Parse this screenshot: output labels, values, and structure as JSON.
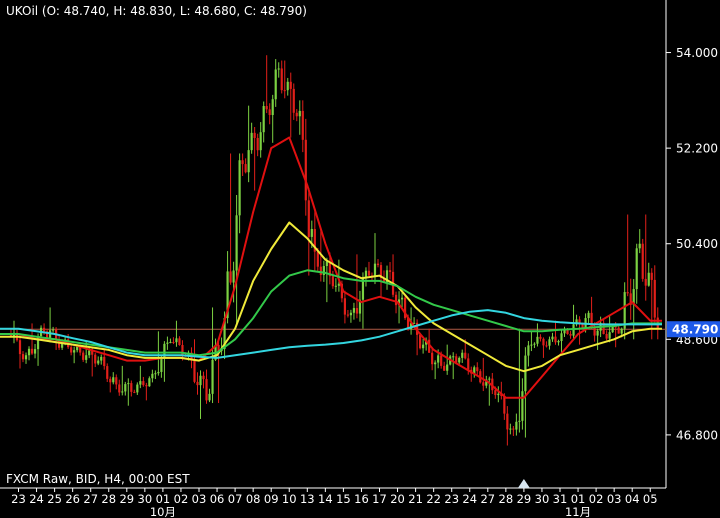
{
  "header": {
    "title": "UKOil (O: 48.740, H: 48.830, L: 48.680, C: 48.790)"
  },
  "footer": {
    "info": "FXCM Raw, BID, H4, 00:00 EST"
  },
  "colors": {
    "background": "#000000",
    "bull": "#7cd142",
    "bear": "#e2201a",
    "ma_red": "#e01010",
    "ma_yellow": "#f0ea3a",
    "ma_green": "#33c94a",
    "ma_cyan": "#33d6e0",
    "price_line": "#b05a45",
    "price_label_bg": "#1e5ae8",
    "axis": "#ffffff"
  },
  "chart_data": {
    "type": "candlestick",
    "symbol": "UKOil",
    "timeframe": "H4",
    "last_price": 48.79,
    "last_price_label": "48.790",
    "ylim": [
      45.8,
      54.5
    ],
    "yticks": [
      {
        "value": 54.0,
        "label": "54.000"
      },
      {
        "value": 52.2,
        "label": "52.200"
      },
      {
        "value": 50.4,
        "label": "50.400"
      },
      {
        "value": 48.6,
        "label": "48.600"
      },
      {
        "value": 46.8,
        "label": "46.800"
      }
    ],
    "xticks": [
      "23",
      "24",
      "25",
      "26",
      "27",
      "28",
      "29",
      "30",
      "01",
      "02",
      "03",
      "06",
      "07",
      "08",
      "09",
      "10",
      "13",
      "14",
      "15",
      "16",
      "17",
      "20",
      "21",
      "22",
      "23",
      "24",
      "27",
      "28",
      "29",
      "30",
      "31",
      "01",
      "02",
      "03",
      "04",
      "05"
    ],
    "month_labels": [
      {
        "text": "10月",
        "tick_index": 8
      },
      {
        "text": "11月",
        "tick_index": 31
      }
    ],
    "marker_tick_index": 28,
    "days": [
      {
        "o": 48.7,
        "h": 48.95,
        "l": 48.05,
        "c": 48.3
      },
      {
        "o": 48.3,
        "h": 48.9,
        "l": 48.1,
        "c": 48.75
      },
      {
        "o": 48.75,
        "h": 49.2,
        "l": 48.4,
        "c": 48.55
      },
      {
        "o": 48.55,
        "h": 48.7,
        "l": 48.15,
        "c": 48.35
      },
      {
        "o": 48.35,
        "h": 48.55,
        "l": 47.9,
        "c": 48.2
      },
      {
        "o": 48.2,
        "h": 48.4,
        "l": 47.6,
        "c": 47.75
      },
      {
        "o": 47.75,
        "h": 48.1,
        "l": 47.35,
        "c": 47.6
      },
      {
        "o": 47.6,
        "h": 48.1,
        "l": 47.45,
        "c": 47.95
      },
      {
        "o": 47.95,
        "h": 48.75,
        "l": 47.8,
        "c": 48.55
      },
      {
        "o": 48.55,
        "h": 48.95,
        "l": 48.2,
        "c": 48.35
      },
      {
        "o": 48.35,
        "h": 48.6,
        "l": 47.1,
        "c": 47.45
      },
      {
        "o": 47.45,
        "h": 49.2,
        "l": 47.4,
        "c": 49.0
      },
      {
        "o": 49.0,
        "h": 52.1,
        "l": 48.9,
        "c": 51.9
      },
      {
        "o": 51.9,
        "h": 53.0,
        "l": 51.4,
        "c": 52.5
      },
      {
        "o": 52.5,
        "h": 53.95,
        "l": 52.3,
        "c": 53.7
      },
      {
        "o": 53.7,
        "h": 53.85,
        "l": 52.4,
        "c": 52.8
      },
      {
        "o": 52.8,
        "h": 53.1,
        "l": 49.8,
        "c": 50.25
      },
      {
        "o": 50.25,
        "h": 50.7,
        "l": 49.3,
        "c": 49.6
      },
      {
        "o": 49.6,
        "h": 50.1,
        "l": 48.9,
        "c": 49.1
      },
      {
        "o": 49.1,
        "h": 50.2,
        "l": 48.8,
        "c": 49.8
      },
      {
        "o": 49.8,
        "h": 50.6,
        "l": 49.4,
        "c": 49.9
      },
      {
        "o": 49.9,
        "h": 50.2,
        "l": 48.9,
        "c": 49.0
      },
      {
        "o": 49.0,
        "h": 49.2,
        "l": 48.3,
        "c": 48.5
      },
      {
        "o": 48.5,
        "h": 48.8,
        "l": 47.85,
        "c": 48.1
      },
      {
        "o": 48.1,
        "h": 48.5,
        "l": 47.85,
        "c": 48.25
      },
      {
        "o": 48.25,
        "h": 48.6,
        "l": 47.8,
        "c": 48.0
      },
      {
        "o": 48.0,
        "h": 48.25,
        "l": 47.35,
        "c": 47.55
      },
      {
        "o": 47.55,
        "h": 47.8,
        "l": 46.6,
        "c": 46.9
      },
      {
        "o": 46.9,
        "h": 48.8,
        "l": 46.75,
        "c": 48.5
      },
      {
        "o": 48.5,
        "h": 48.9,
        "l": 48.25,
        "c": 48.6
      },
      {
        "o": 48.6,
        "h": 48.95,
        "l": 48.35,
        "c": 48.7
      },
      {
        "o": 48.7,
        "h": 49.25,
        "l": 48.5,
        "c": 49.0
      },
      {
        "o": 49.0,
        "h": 49.4,
        "l": 48.4,
        "c": 48.7
      },
      {
        "o": 48.7,
        "h": 49.05,
        "l": 48.45,
        "c": 48.8
      },
      {
        "o": 48.8,
        "h": 50.95,
        "l": 48.6,
        "c": 50.4
      },
      {
        "o": 50.4,
        "h": 50.95,
        "l": 48.6,
        "c": 48.79
      }
    ],
    "series": [
      {
        "color": "#e01010",
        "values": [
          48.7,
          48.6,
          48.6,
          48.5,
          48.4,
          48.3,
          48.2,
          48.2,
          48.25,
          48.25,
          48.2,
          48.5,
          49.6,
          51.0,
          52.2,
          52.4,
          51.5,
          50.4,
          49.5,
          49.3,
          49.4,
          49.3,
          48.8,
          48.4,
          48.2,
          48.0,
          47.8,
          47.5,
          47.5,
          47.9,
          48.3,
          48.7,
          48.9,
          49.1,
          49.3,
          48.95
        ]
      },
      {
        "color": "#f0ea3a",
        "values": [
          48.65,
          48.6,
          48.55,
          48.5,
          48.45,
          48.4,
          48.3,
          48.25,
          48.25,
          48.25,
          48.2,
          48.3,
          48.8,
          49.7,
          50.3,
          50.8,
          50.5,
          50.1,
          49.9,
          49.75,
          49.8,
          49.6,
          49.2,
          48.9,
          48.7,
          48.5,
          48.3,
          48.1,
          48.0,
          48.1,
          48.3,
          48.4,
          48.5,
          48.6,
          48.75,
          48.8
        ]
      },
      {
        "color": "#33c94a",
        "values": [
          48.7,
          48.65,
          48.6,
          48.55,
          48.5,
          48.45,
          48.4,
          48.35,
          48.35,
          48.35,
          48.3,
          48.35,
          48.6,
          49.0,
          49.5,
          49.8,
          49.9,
          49.85,
          49.75,
          49.7,
          49.7,
          49.6,
          49.4,
          49.25,
          49.15,
          49.05,
          48.95,
          48.85,
          48.75,
          48.75,
          48.78,
          48.8,
          48.83,
          48.85,
          48.9,
          48.9
        ]
      },
      {
        "color": "#33d6e0",
        "values": [
          48.8,
          48.75,
          48.7,
          48.62,
          48.55,
          48.45,
          48.35,
          48.3,
          48.3,
          48.3,
          48.27,
          48.25,
          48.3,
          48.35,
          48.4,
          48.45,
          48.48,
          48.5,
          48.53,
          48.58,
          48.65,
          48.75,
          48.85,
          48.95,
          49.05,
          49.12,
          49.15,
          49.1,
          49.0,
          48.95,
          48.92,
          48.9,
          48.88,
          48.88,
          48.88,
          48.88
        ]
      }
    ]
  }
}
